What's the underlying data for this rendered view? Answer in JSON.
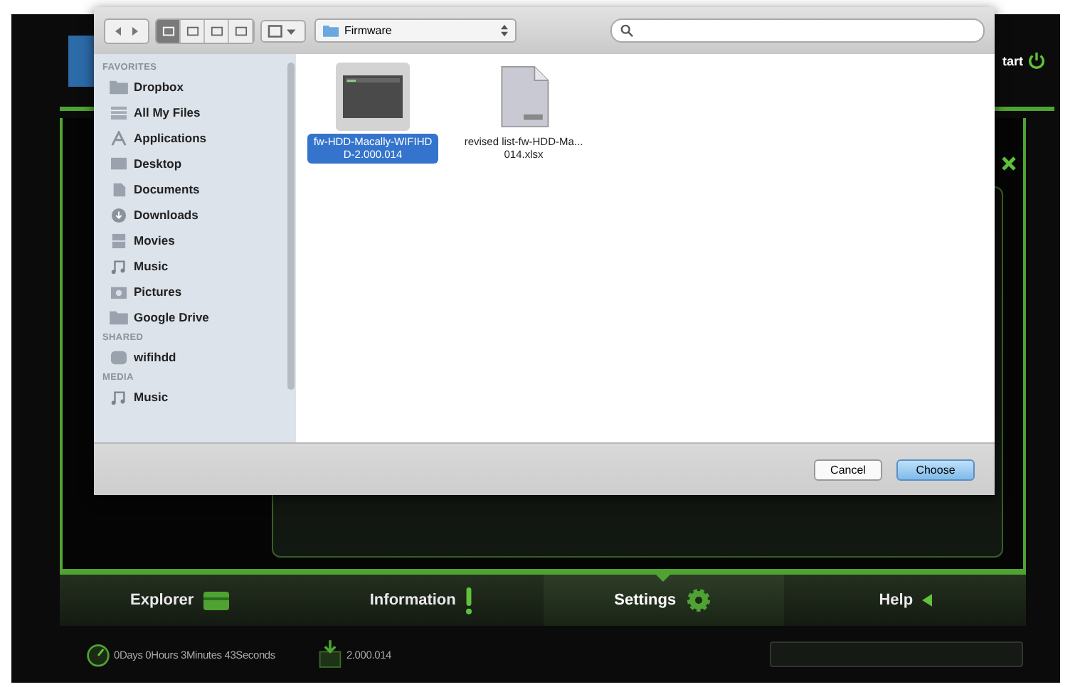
{
  "header": {
    "restart_label": "tart"
  },
  "dialog": {
    "toolbar": {
      "view_modes": [
        {
          "selected": true
        },
        {
          "selected": false
        },
        {
          "selected": false
        },
        {
          "selected": false
        }
      ],
      "location": "Firmware"
    },
    "sidebar": [
      {
        "heading": "FAVORITES",
        "items": [
          {
            "label": "Dropbox",
            "kind": "folder"
          },
          {
            "label": "All My Files",
            "kind": "files"
          },
          {
            "label": "Applications",
            "kind": "apps"
          },
          {
            "label": "Desktop",
            "kind": "desktop"
          },
          {
            "label": "Documents",
            "kind": "documents"
          },
          {
            "label": "Downloads",
            "kind": "downloads"
          },
          {
            "label": "Movies",
            "kind": "movies"
          },
          {
            "label": "Music",
            "kind": "music"
          },
          {
            "label": "Pictures",
            "kind": "pictures"
          },
          {
            "label": "Google Drive",
            "kind": "folder"
          }
        ]
      },
      {
        "heading": "SHARED",
        "items": [
          {
            "label": "wifihdd",
            "kind": "server"
          }
        ]
      },
      {
        "heading": "MEDIA",
        "items": [
          {
            "label": "Music",
            "kind": "music"
          }
        ]
      }
    ],
    "files": [
      {
        "name": "fw-HDD-Macally-WIFIHDD-2.000.014",
        "kind": "firmware",
        "selected": true
      },
      {
        "name": "revised list-fw-HDD-Ma...014.xlsx",
        "kind": "spreadsheet",
        "selected": false
      }
    ],
    "buttons": [
      {
        "label": "Cancel",
        "kind": "secondary"
      },
      {
        "label": "Choose",
        "kind": "default"
      }
    ]
  },
  "nav": [
    {
      "label": "Explorer",
      "kind": "explorer",
      "selected": false
    },
    {
      "label": "Information",
      "kind": "information",
      "selected": false
    },
    {
      "label": "Settings",
      "kind": "settings",
      "selected": true
    },
    {
      "label": "Help",
      "kind": "help",
      "selected": false
    }
  ],
  "status_bar": {
    "uptime": "0Days 0Hours 3Minutes 43Seconds",
    "version": "2.000.014"
  }
}
